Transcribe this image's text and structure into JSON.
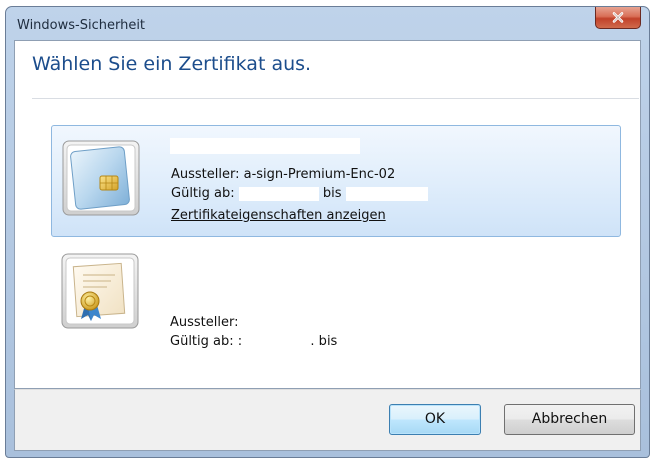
{
  "window": {
    "title": "Windows-Sicherheit"
  },
  "dialog": {
    "heading": "Wählen Sie ein Zertifikat aus."
  },
  "certificates": [
    {
      "issuer_label": "Aussteller: ",
      "issuer": "a-sign-Premium-Enc-02",
      "valid_from_label": "Gültig ab:",
      "to_label": "bis",
      "properties_link": "Zertifikateigenschaften anzeigen",
      "icon": "smartcard-icon",
      "selected": true
    },
    {
      "issuer_label": "Aussteller:",
      "valid_from_label": "Gültig ab: :",
      "to_label": ". bis",
      "icon": "certificate-seal-icon",
      "selected": false
    }
  ],
  "buttons": {
    "ok": "OK",
    "cancel": "Abbrechen"
  },
  "colors": {
    "heading": "#1c4d8c",
    "selection_border": "#8fb8e0",
    "close_button": "#c1412a"
  }
}
